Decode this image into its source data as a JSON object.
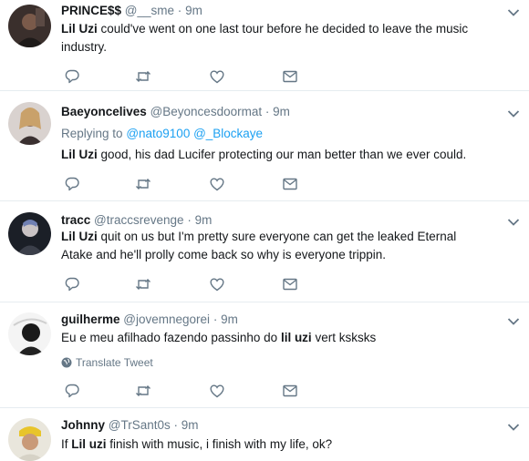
{
  "tweets": [
    {
      "name": "PRINCE$$",
      "handle": "@__sme",
      "dot": "·",
      "time": "9m",
      "reply_label": "",
      "reply_users": "",
      "mention": "Lil Uzi",
      "text_rest": " could've went on one last tour before he decided to leave the music industry.",
      "translate": ""
    },
    {
      "name": "Baeyoncelives",
      "handle": "@Beyoncesdoormat",
      "dot": "·",
      "time": "9m",
      "reply_label": "Replying to",
      "reply_users": "@nato9100 @_Blockaye",
      "mention": "Lil Uzi",
      "text_rest": " good, his dad Lucifer protecting our man better than we ever could.",
      "translate": ""
    },
    {
      "name": "tracc",
      "handle": "@traccsrevenge",
      "dot": "·",
      "time": "9m",
      "reply_label": "",
      "reply_users": "",
      "mention": "Lil Uzi",
      "text_rest": " quit on us but I'm pretty sure everyone can get the leaked Eternal Atake and he'll prolly come back so why is everyone trippin.",
      "translate": ""
    },
    {
      "name": "guilherme",
      "handle": "@jovemnegorei",
      "dot": "·",
      "time": "9m",
      "reply_label": "",
      "reply_users": "",
      "text_pre": "Eu e meu afilhado fazendo passinho do ",
      "mention": "lil uzi",
      "text_rest": " vert ksksks",
      "translate": "Translate Tweet"
    },
    {
      "name": "Johnny",
      "handle": "@TrSant0s",
      "dot": "·",
      "time": "9m",
      "reply_label": "",
      "reply_users": "",
      "text_pre": "If ",
      "mention": "Lil uzi",
      "text_rest": " finish with music, i finish with my life, ok?",
      "translate": ""
    }
  ],
  "icons": {
    "reply": "reply-icon",
    "retweet": "retweet-icon",
    "like": "heart-icon",
    "dm": "envelope-icon",
    "more": "chevron-down-icon",
    "translate": "globe-icon"
  },
  "colors": {
    "text": "#14171a",
    "secondary": "#657786",
    "link": "#1da1f2",
    "divider": "#e6ecf0"
  }
}
